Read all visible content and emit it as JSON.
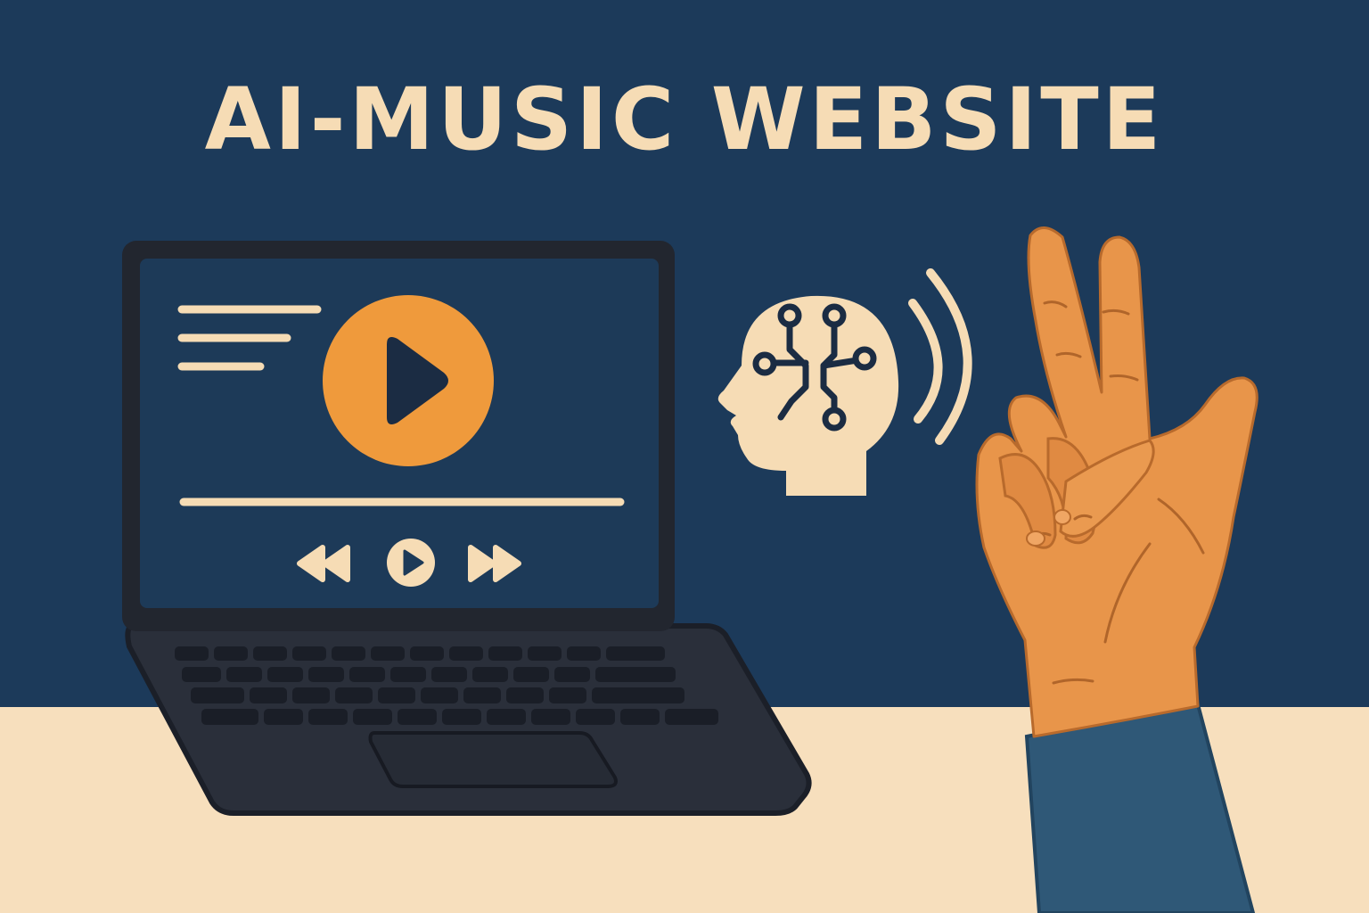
{
  "title": "AI-MUSIC WEBSITE",
  "colors": {
    "background": "#1c3a5a",
    "desk": "#f7dfbd",
    "title_text": "#f6dcb5",
    "laptop_body": "#2a2f3a",
    "laptop_screen": "#1d3a58",
    "accent_orange": "#ef9a3c",
    "icon_dark": "#1b2c43",
    "cream": "#f6dcb5",
    "skin": "#e8954a",
    "sleeve": "#2f5877"
  },
  "icons": {
    "play_main": "play-triangle-icon",
    "rewind": "rewind-icon",
    "play_small": "play-circle-icon",
    "fast_forward": "fast-forward-icon",
    "ai_head": "ai-brain-head-icon",
    "sound_waves": "sound-waves-icon",
    "hand": "hand-gesture"
  }
}
